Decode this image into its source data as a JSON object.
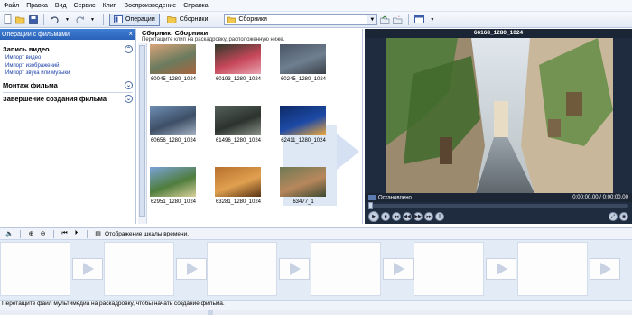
{
  "menu": [
    "Файл",
    "Правка",
    "Вид",
    "Сервис",
    "Клип",
    "Воспроизведение",
    "Справка"
  ],
  "toolbar": {
    "operations_label": "Операции",
    "collections_label": "Сборники",
    "collection_select_value": "Сборники"
  },
  "tasks": {
    "header": "Операции с фильмами",
    "close": "×",
    "sections": [
      {
        "title": "Запись видео",
        "links": [
          "Импорт видео",
          "Импорт изображений",
          "Импорт звука или музыки"
        ]
      },
      {
        "title": "Монтаж фильма",
        "links": []
      },
      {
        "title": "Завершение создания фильма",
        "links": []
      }
    ]
  },
  "collection": {
    "title": "Сборник: Сборники",
    "subtitle": "Перетащите клип на раскадровку, расположенную ниже.",
    "items": [
      {
        "label": "60045_1280_1024",
        "colors": [
          "#d9a47a",
          "#6b7b5e",
          "#a8643e"
        ]
      },
      {
        "label": "60193_1280_1024",
        "colors": [
          "#2f3a2a",
          "#c7475a",
          "#e9a3b0"
        ]
      },
      {
        "label": "60245_1280_1024",
        "colors": [
          "#4a5566",
          "#6f7f8f",
          "#3a4049"
        ]
      },
      {
        "label": "60656_1280_1024",
        "colors": [
          "#6f8fb6",
          "#3d4f66",
          "#a6b3c4"
        ]
      },
      {
        "label": "61496_1280_1024",
        "colors": [
          "#55615a",
          "#2c332f",
          "#8b938a"
        ]
      },
      {
        "label": "62411_1280_1024",
        "colors": [
          "#0d2a66",
          "#1d4aa6",
          "#f0a93a"
        ]
      },
      {
        "label": "62951_1280_1024",
        "colors": [
          "#7aa3d9",
          "#4f7d3d",
          "#d8d09a"
        ]
      },
      {
        "label": "63281_1280_1024",
        "colors": [
          "#b8702c",
          "#e0a050",
          "#5a3416"
        ]
      },
      {
        "label": "63477_1",
        "colors": [
          "#6e7a55",
          "#b8875c",
          "#3d4a31"
        ]
      }
    ]
  },
  "monitor": {
    "title": "66168_1280_1024",
    "status": "Остановлено",
    "time": "0:00:00,00 / 0:00:00,00",
    "progress": 0
  },
  "storyboard": {
    "show_timeline_label": "Отображение шкалы времени.",
    "slot_count": 6
  },
  "status_bar": "Перетащите файл мультимедиа на раскадровку, чтобы начать создание фильма.",
  "colors": {
    "accent": "#2a62b8",
    "storyboard_bg": "#e3ebf6",
    "monitor_bg": "#1f2b3e"
  }
}
